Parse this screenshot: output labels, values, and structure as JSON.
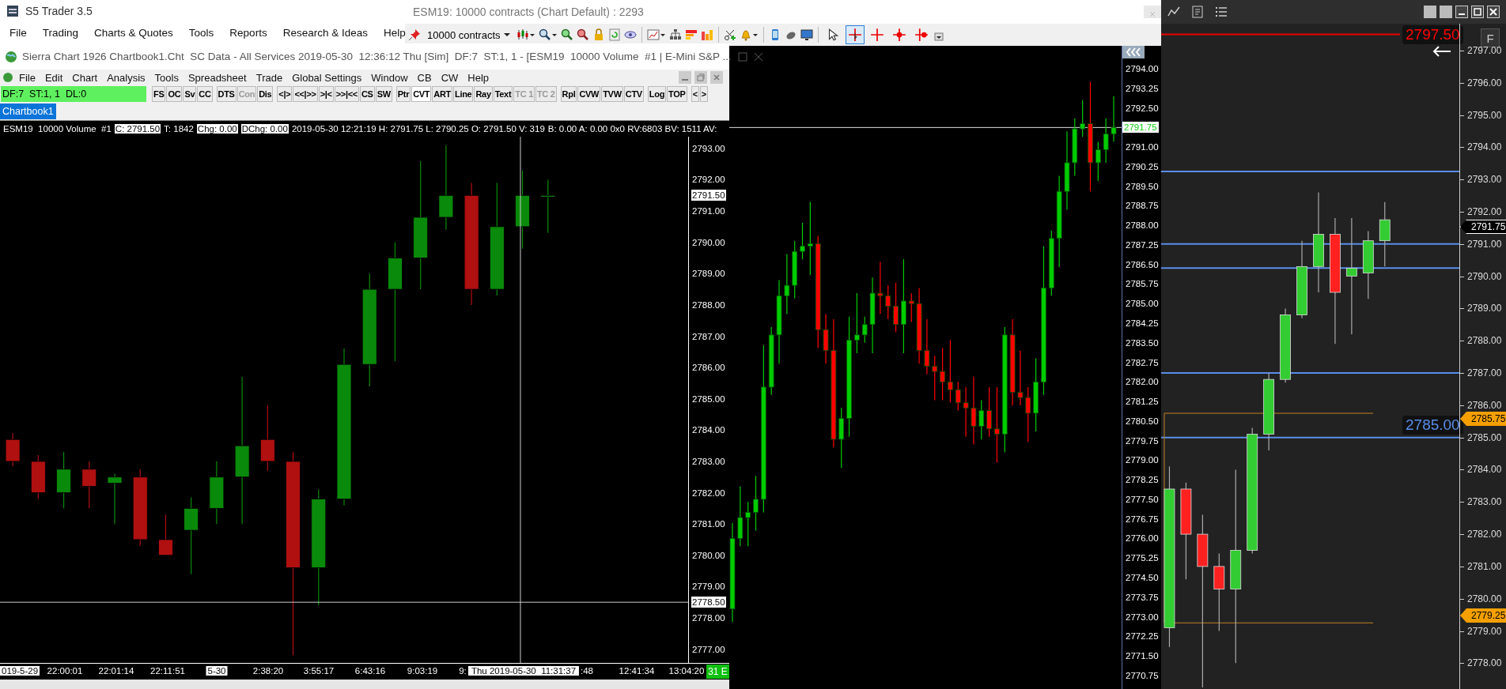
{
  "s5_window": {
    "title": "S5 Trader 3.5",
    "menu": [
      "File",
      "Trading",
      "Charts & Quotes",
      "Tools",
      "Reports",
      "Research & Ideas",
      "Help"
    ]
  },
  "contracts_chart": {
    "title": "ESM19: 10000 contracts (Chart Default) : 2293",
    "contracts": "10000 contracts",
    "drawing_tools": [
      {
        "kind": "pointer",
        "selected": false
      },
      {
        "kind": "crosshair",
        "selected": true
      },
      {
        "kind": "cross",
        "selected": false
      },
      {
        "kind": "cross_dot",
        "selected": false
      },
      {
        "kind": "cross_dot_right",
        "selected": false
      }
    ],
    "last_price": "2791.75",
    "chart_data": {
      "type": "candlestick",
      "ylim": [
        2770.23,
        2794.88
      ],
      "categories": [
        null,
        null,
        null,
        null,
        null,
        null,
        null,
        null,
        null,
        null,
        null,
        null,
        null,
        null,
        null,
        null,
        null,
        null,
        null,
        null,
        null,
        null,
        null,
        null,
        null,
        null,
        null,
        null,
        null,
        null,
        null,
        null,
        null,
        null,
        null,
        null,
        null,
        null,
        null,
        null,
        null,
        null,
        null,
        null,
        null,
        null,
        null,
        null,
        null,
        null
      ],
      "yticks": [
        {
          "value": 2794,
          "label": "2794.00"
        },
        {
          "value": 2793.25,
          "label": "2793.25"
        },
        {
          "value": 2792.5,
          "label": "2792.50"
        },
        {
          "value": 2791,
          "label": "2791.00"
        },
        {
          "value": 2790.25,
          "label": "2790.25"
        },
        {
          "value": 2789.5,
          "label": "2789.50"
        },
        {
          "value": 2788.75,
          "label": "2788.75"
        },
        {
          "value": 2788,
          "label": "2788.00"
        },
        {
          "value": 2787.25,
          "label": "2787.25"
        },
        {
          "value": 2786.5,
          "label": "2786.50"
        },
        {
          "value": 2785.75,
          "label": "2785.75"
        },
        {
          "value": 2785,
          "label": "2785.00"
        },
        {
          "value": 2784.25,
          "label": "2784.25"
        },
        {
          "value": 2783.5,
          "label": "2783.50"
        },
        {
          "value": 2782.75,
          "label": "2782.75"
        },
        {
          "value": 2782,
          "label": "2782.00"
        },
        {
          "value": 2781.25,
          "label": "2781.25"
        },
        {
          "value": 2780.5,
          "label": "2780.50"
        },
        {
          "value": 2779.75,
          "label": "2779.75"
        },
        {
          "value": 2779,
          "label": "2779.00"
        },
        {
          "value": 2778.25,
          "label": "2778.25"
        },
        {
          "value": 2777.5,
          "label": "2777.50"
        },
        {
          "value": 2776.75,
          "label": "2776.75"
        },
        {
          "value": 2776,
          "label": "2776.00"
        },
        {
          "value": 2775.25,
          "label": "2775.25"
        },
        {
          "value": 2774.5,
          "label": "2774.50"
        },
        {
          "value": 2773.75,
          "label": "2773.75"
        },
        {
          "value": 2773,
          "label": "2773.00"
        },
        {
          "value": 2772.25,
          "label": "2772.25"
        },
        {
          "value": 2771.5,
          "label": "2771.50"
        },
        {
          "value": 2770.75,
          "label": "2770.75"
        }
      ],
      "ohlc": [
        [
          2773.3,
          2776.6,
          2772.8,
          2776.0
        ],
        [
          2776.0,
          2778.0,
          2775.7,
          2776.8
        ],
        [
          2776.8,
          2777.4,
          2775.7,
          2777.0
        ],
        [
          2777.0,
          2778.4,
          2776.3,
          2777.5
        ],
        [
          2777.5,
          2783.4,
          2777.0,
          2781.8
        ],
        [
          2781.8,
          2784.1,
          2781.5,
          2783.8
        ],
        [
          2783.8,
          2785.9,
          2782.7,
          2785.3
        ],
        [
          2785.3,
          2786.9,
          2784.6,
          2785.7
        ],
        [
          2785.7,
          2787.4,
          2785.2,
          2787.0
        ],
        [
          2787.0,
          2788.1,
          2786.7,
          2787.2
        ],
        [
          2787.2,
          2788.9,
          2786.1,
          2787.3
        ],
        [
          2787.3,
          2787.6,
          2783.3,
          2784.0
        ],
        [
          2784.0,
          2784.6,
          2782.7,
          2783.2
        ],
        [
          2783.2,
          2784.4,
          2779.5,
          2779.8
        ],
        [
          2779.8,
          2781.0,
          2778.7,
          2780.6
        ],
        [
          2780.6,
          2784.5,
          2779.9,
          2783.6
        ],
        [
          2783.6,
          2785.4,
          2783.1,
          2783.8
        ],
        [
          2783.8,
          2784.5,
          2783.5,
          2784.2
        ],
        [
          2784.2,
          2786.0,
          2783.1,
          2785.4
        ],
        [
          2785.4,
          2786.6,
          2784.6,
          2785.3
        ],
        [
          2785.3,
          2785.7,
          2784.4,
          2784.9
        ],
        [
          2784.9,
          2785.8,
          2783.9,
          2784.2
        ],
        [
          2784.2,
          2786.7,
          2783.1,
          2785.1
        ],
        [
          2785.1,
          2785.4,
          2784.3,
          2785.0
        ],
        [
          2785.0,
          2785.6,
          2782.7,
          2783.2
        ],
        [
          2783.2,
          2784.4,
          2782.3,
          2782.6
        ],
        [
          2782.6,
          2783.0,
          2781.3,
          2782.4
        ],
        [
          2782.4,
          2783.3,
          2781.3,
          2782.0
        ],
        [
          2782.0,
          2783.6,
          2781.2,
          2781.7
        ],
        [
          2781.7,
          2782.0,
          2780.9,
          2781.2
        ],
        [
          2781.2,
          2781.8,
          2779.9,
          2781.0
        ],
        [
          2781.0,
          2782.2,
          2779.6,
          2780.3
        ],
        [
          2780.3,
          2781.3,
          2779.8,
          2780.9
        ],
        [
          2780.9,
          2781.8,
          2779.9,
          2780.2
        ],
        [
          2780.2,
          2781.8,
          2778.9,
          2780.0
        ],
        [
          2780.0,
          2784.1,
          2779.3,
          2783.8
        ],
        [
          2783.8,
          2784.4,
          2781.1,
          2781.6
        ],
        [
          2781.6,
          2783.2,
          2781.1,
          2781.4
        ],
        [
          2781.4,
          2781.8,
          2779.7,
          2780.8
        ],
        [
          2780.8,
          2782.9,
          2780.1,
          2782.0
        ],
        [
          2782.0,
          2787.2,
          2781.5,
          2785.6
        ],
        [
          2785.6,
          2787.8,
          2785.3,
          2787.5
        ],
        [
          2787.5,
          2789.9,
          2786.4,
          2789.3
        ],
        [
          2789.3,
          2791.6,
          2788.6,
          2790.4
        ],
        [
          2790.4,
          2792.1,
          2789.9,
          2791.7
        ],
        [
          2791.7,
          2792.8,
          2791.4,
          2791.9
        ],
        [
          2791.9,
          2793.5,
          2789.3,
          2790.4
        ],
        [
          2790.4,
          2791.2,
          2789.7,
          2790.9
        ],
        [
          2790.9,
          2792.1,
          2790.4,
          2791.5
        ],
        [
          2791.5,
          2792.95,
          2791.2,
          2791.75
        ]
      ]
    }
  },
  "sierra_window": {
    "title": "Sierra Chart 1926 Chartbook1.Cht  SC Data - All Services 2019-05-30  12:36:12 Thu [Sim]  DF:7  ST:1, 1 - [ESM19  10000 Volume  #1 | E-Mini S&P ...",
    "menu": [
      "File",
      "Edit",
      "Chart",
      "Analysis",
      "Tools",
      "Spreadsheet",
      "Trade",
      "Global Settings",
      "Window",
      "CB",
      "CW",
      "Help"
    ],
    "status": "DF:7  ST:1, 1  DL:0",
    "button_groups": [
      [
        {
          "label": "FS",
          "disabled": false,
          "selected": false
        },
        {
          "label": "OC",
          "disabled": false,
          "selected": false
        },
        {
          "label": "Sv",
          "disabled": false,
          "selected": false
        },
        {
          "label": "CC",
          "disabled": false,
          "selected": false
        }
      ],
      [
        {
          "label": "DTS",
          "disabled": false,
          "selected": false
        },
        {
          "label": "Con",
          "disabled": true,
          "selected": false
        },
        {
          "label": "Dis",
          "disabled": false,
          "selected": false
        }
      ],
      [
        {
          "label": "<|>",
          "disabled": false,
          "selected": false
        },
        {
          "label": "<<|>>",
          "disabled": false,
          "selected": false
        },
        {
          "label": ">|<",
          "disabled": false,
          "selected": false
        },
        {
          "label": ">>|<<",
          "disabled": false,
          "selected": false
        },
        {
          "label": "CS",
          "disabled": false,
          "selected": false
        },
        {
          "label": "SW",
          "disabled": false,
          "selected": false
        }
      ],
      [
        {
          "label": "Ptr",
          "disabled": false,
          "selected": false
        },
        {
          "label": "CVT",
          "disabled": false,
          "selected": true
        },
        {
          "label": "ART",
          "disabled": false,
          "selected": false
        },
        {
          "label": "Line",
          "disabled": false,
          "selected": false
        },
        {
          "label": "Ray",
          "disabled": false,
          "selected": false
        },
        {
          "label": "Text",
          "disabled": false,
          "selected": false
        },
        {
          "label": "TC 1",
          "disabled": true,
          "selected": false
        },
        {
          "label": "TC 2",
          "disabled": true,
          "selected": false
        }
      ],
      [
        {
          "label": "Rpl",
          "disabled": false,
          "selected": false
        },
        {
          "label": "CVW",
          "disabled": false,
          "selected": false
        },
        {
          "label": "TVW",
          "disabled": false,
          "selected": false
        },
        {
          "label": "CTV",
          "disabled": false,
          "selected": false
        }
      ],
      [
        {
          "label": "Log",
          "disabled": false,
          "selected": false
        },
        {
          "label": "TOP",
          "disabled": false,
          "selected": false
        }
      ],
      [
        {
          "label": "<",
          "disabled": false,
          "selected": false
        },
        {
          "label": ">",
          "disabled": false,
          "selected": false
        }
      ]
    ],
    "tabs": [
      {
        "label": "Chartbook1",
        "selected": true
      }
    ],
    "info": [
      {
        "text": "ESM19  10000 Volume  #1",
        "boxed": false
      },
      {
        "text": "C: 2791.50",
        "boxed": true
      },
      {
        "text": "T: 1842",
        "boxed": false
      },
      {
        "text": "Chg: 0.00",
        "boxed": true
      },
      {
        "text": "DChg: 0.00",
        "boxed": true
      },
      {
        "text": "2019-05-30 12:21:19 H: 2791.75 L: 2790.25 O: 2791.50 V: 319",
        "boxed": false
      },
      {
        "text": "B: 0.00 A: 0.00 0x0 RV:6803 BV: 1511 AV:",
        "boxed": false
      }
    ],
    "price_markers": [
      "2791.50",
      "2778.50"
    ],
    "time_labels": [
      {
        "text": "019-5-29",
        "kind": "date"
      },
      {
        "text": "22:00:01",
        "kind": "time"
      },
      {
        "text": "22:01:14",
        "kind": "time"
      },
      {
        "text": "22:11:51",
        "kind": "time"
      },
      {
        "text": "5-30",
        "kind": "date"
      },
      {
        "text": "2:38:20",
        "kind": "time"
      },
      {
        "text": "3:55:17",
        "kind": "time"
      },
      {
        "text": "6:43:16",
        "kind": "time"
      },
      {
        "text": "9:03:19",
        "kind": "time"
      },
      {
        "text": "9:",
        "kind": "time"
      },
      {
        "text": "Thu 2019-05-30  11:31:37",
        "kind": "cursor"
      },
      {
        "text": ":48",
        "kind": "time"
      },
      {
        "text": "12:41:34",
        "kind": "time"
      },
      {
        "text": "13:04:20",
        "kind": "time"
      }
    ],
    "corner_badge": "31 E",
    "chart_data": {
      "type": "candlestick",
      "ylim": [
        2776.51,
        2793.88
      ],
      "categories": [
        null,
        null,
        null,
        null,
        null,
        null,
        null,
        null,
        null,
        null,
        null,
        null,
        null,
        null,
        null,
        null,
        null,
        null,
        null,
        null,
        null,
        null,
        null,
        null,
        null,
        null,
        null
      ],
      "yticks": [
        {
          "value": 2793,
          "label": "2793.00"
        },
        {
          "value": 2792,
          "label": "2792.00"
        },
        {
          "value": 2791,
          "label": "2791.00"
        },
        {
          "value": 2790,
          "label": "2790.00"
        },
        {
          "value": 2789,
          "label": "2789.00"
        },
        {
          "value": 2788,
          "label": "2788.00"
        },
        {
          "value": 2787,
          "label": "2787.00"
        },
        {
          "value": 2786,
          "label": "2786.00"
        },
        {
          "value": 2785,
          "label": "2785.00"
        },
        {
          "value": 2784,
          "label": "2784.00"
        },
        {
          "value": 2783,
          "label": "2783.00"
        },
        {
          "value": 2782,
          "label": "2782.00"
        },
        {
          "value": 2781,
          "label": "2781.00"
        },
        {
          "value": 2780,
          "label": "2780.00"
        },
        {
          "value": 2779,
          "label": "2779.00"
        },
        {
          "value": 2778,
          "label": "2778.00"
        },
        {
          "value": 2777,
          "label": "2777.00"
        }
      ],
      "ohlc": [
        [
          2783.7,
          2783.9,
          2782.85,
          2783.0
        ],
        [
          2783.0,
          2783.2,
          2781.8,
          2782.0
        ],
        [
          2782.0,
          2783.3,
          2781.5,
          2782.75
        ],
        [
          2782.75,
          2783.0,
          2781.5,
          2782.2
        ],
        [
          2782.3,
          2782.6,
          2781.0,
          2782.5
        ],
        [
          2782.5,
          2782.75,
          2780.3,
          2780.5
        ],
        [
          2780.5,
          2781.3,
          2780.0,
          2780.0
        ],
        [
          2780.8,
          2781.85,
          2779.4,
          2781.5
        ],
        [
          2781.5,
          2783.0,
          2781.0,
          2782.5
        ],
        [
          2782.5,
          2785.7,
          2781.0,
          2783.5
        ],
        [
          2783.7,
          2784.8,
          2782.7,
          2783.0
        ],
        [
          2783.0,
          2783.3,
          2776.8,
          2779.6
        ],
        [
          2779.6,
          2782.1,
          2778.4,
          2781.8
        ],
        [
          2781.8,
          2786.6,
          2781.6,
          2786.1
        ],
        [
          2786.1,
          2789.0,
          2785.4,
          2788.5
        ],
        [
          2788.5,
          2790.0,
          2786.2,
          2789.5
        ],
        [
          2789.5,
          2792.6,
          2788.5,
          2790.8
        ],
        [
          2790.8,
          2793.1,
          2790.4,
          2791.5
        ],
        [
          2791.5,
          2791.9,
          2788.0,
          2788.5
        ],
        [
          2788.5,
          2791.9,
          2788.3,
          2790.5
        ],
        [
          2790.5,
          2792.3,
          2789.8,
          2791.5
        ],
        [
          2791.5,
          2792.0,
          2790.3,
          2791.5
        ],
        null,
        null,
        null,
        null,
        null
      ]
    }
  },
  "dom_chart": {
    "axis_button": "F",
    "price_tags": [
      {
        "text": "2791.75",
        "kind": "last"
      },
      {
        "text": "2785.75",
        "kind": "order"
      },
      {
        "text": "2779.25",
        "kind": "order"
      }
    ],
    "line_labels": [
      {
        "text": "2797.50",
        "kind": "alert"
      },
      {
        "text": "2785.00",
        "kind": "level"
      }
    ],
    "chart_data": {
      "type": "candlestick",
      "ylim": [
        2777.2,
        2797.83
      ],
      "categories": [
        null,
        null,
        null,
        null,
        null,
        null,
        null,
        null,
        null,
        null,
        null,
        null,
        null,
        null,
        null,
        null,
        null,
        null
      ],
      "yticks": [
        {
          "value": 2797,
          "label": "2797.00"
        },
        {
          "value": 2796,
          "label": "2796.00"
        },
        {
          "value": 2795,
          "label": "2795.00"
        },
        {
          "value": 2794,
          "label": "2794.00"
        },
        {
          "value": 2793,
          "label": "2793.00"
        },
        {
          "value": 2792,
          "label": "2792.00"
        },
        {
          "value": 2791,
          "label": "2791.00"
        },
        {
          "value": 2790,
          "label": "2790.00"
        },
        {
          "value": 2789,
          "label": "2789.00"
        },
        {
          "value": 2788,
          "label": "2788.00"
        },
        {
          "value": 2787,
          "label": "2787.00"
        },
        {
          "value": 2786,
          "label": "2786.00"
        },
        {
          "value": 2785,
          "label": "2785.00"
        },
        {
          "value": 2784,
          "label": "2784.00"
        },
        {
          "value": 2783,
          "label": "2783.00"
        },
        {
          "value": 2782,
          "label": "2782.00"
        },
        {
          "value": 2781,
          "label": "2781.00"
        },
        {
          "value": 2780,
          "label": "2780.00"
        },
        {
          "value": 2779,
          "label": "2779.00"
        },
        {
          "value": 2778,
          "label": "2778.00"
        }
      ],
      "ohlc": [
        [
          2779.1,
          2784.1,
          2778.5,
          2783.4
        ],
        [
          2783.4,
          2783.6,
          2780.6,
          2782.0
        ],
        [
          2782.0,
          2782.6,
          2777.25,
          2781.0
        ],
        [
          2781.0,
          2781.4,
          2779.0,
          2780.3
        ],
        [
          2780.3,
          2784.0,
          2778.0,
          2781.5
        ],
        [
          2781.5,
          2785.3,
          2781.4,
          2785.1
        ],
        [
          2785.1,
          2787.0,
          2784.6,
          2786.8
        ],
        [
          2786.8,
          2789.0,
          2786.7,
          2788.8
        ],
        [
          2788.8,
          2791.1,
          2788.7,
          2790.3
        ],
        [
          2790.3,
          2792.6,
          2789.5,
          2791.3
        ],
        [
          2791.3,
          2791.8,
          2787.9,
          2789.5
        ],
        [
          2790.0,
          2791.8,
          2788.2,
          2790.25
        ],
        [
          2790.1,
          2791.4,
          2789.3,
          2791.1
        ],
        [
          2791.1,
          2792.3,
          2790.3,
          2791.75
        ],
        null,
        null,
        null,
        null
      ]
    }
  }
}
